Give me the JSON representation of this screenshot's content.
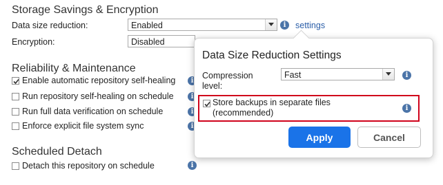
{
  "storage": {
    "title": "Storage Savings & Encryption",
    "data_size_label": "Data size reduction:",
    "data_size_value": "Enabled",
    "settings_link": "settings",
    "encryption_label": "Encryption:",
    "encryption_value": "Disabled"
  },
  "reliability": {
    "title": "Reliability & Maintenance",
    "options": [
      {
        "label": "Enable automatic repository self-healing",
        "checked": true
      },
      {
        "label": "Run repository self-healing on schedule",
        "checked": false
      },
      {
        "label": "Run full data verification on schedule",
        "checked": false
      },
      {
        "label": "Enforce explicit file system sync",
        "checked": false
      }
    ]
  },
  "detach": {
    "title": "Scheduled Detach",
    "option_label": "Detach this repository on schedule",
    "checked": false
  },
  "popup": {
    "title": "Data Size Reduction Settings",
    "compression_label_line1": "Compression",
    "compression_label_line2": "level:",
    "compression_value": "Fast",
    "store_label_line1": "Store backups in separate files",
    "store_label_line2": "(recommended)",
    "store_checked": true,
    "apply_label": "Apply",
    "cancel_label": "Cancel"
  },
  "icons": {
    "info": "info-icon",
    "arrow": "chevron-down-icon",
    "check": "check-icon"
  },
  "colors": {
    "accent": "#1a73e8",
    "highlight_border": "#d0021b",
    "info": "#4b74a8",
    "link": "#2b5ea8"
  }
}
